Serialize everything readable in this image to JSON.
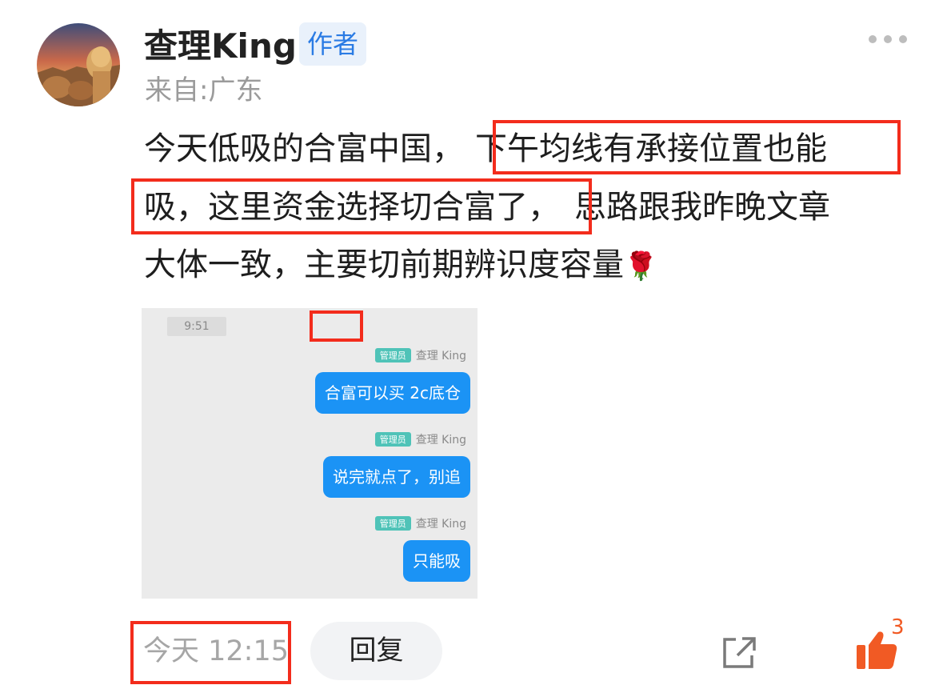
{
  "author": {
    "name": "查理King",
    "badge": "作者",
    "origin": "来自:广东"
  },
  "post": {
    "line1_a": "今天低吸的合富中国，",
    "line1_b": "下午均线有承接位置也能",
    "line2_a": "吸，这里资金选择切合富了，",
    "line2_b": "思路跟我昨晚文章",
    "line3": "大体一致，主要切前期辨识度容量",
    "emoji": "🌹"
  },
  "screenshot": {
    "time": "9:51",
    "messages": [
      {
        "role": "管理员",
        "sender": "查理 King",
        "text": "合富可以买 2c底仓"
      },
      {
        "role": "管理员",
        "sender": "查理 King",
        "text": "说完就点了，别追"
      },
      {
        "role": "管理员",
        "sender": "查理 King",
        "text": "只能吸"
      }
    ]
  },
  "footer": {
    "time": "今天 12:15",
    "reply_label": "回复",
    "like_count": "3"
  },
  "colors": {
    "accent_blue": "#1b93f5",
    "highlight_red": "#f32c1c",
    "like_orange": "#f15a24",
    "badge_blue": "#2a7be4"
  },
  "icons": [
    "more-icon",
    "share-icon",
    "thumbs-up-icon"
  ]
}
